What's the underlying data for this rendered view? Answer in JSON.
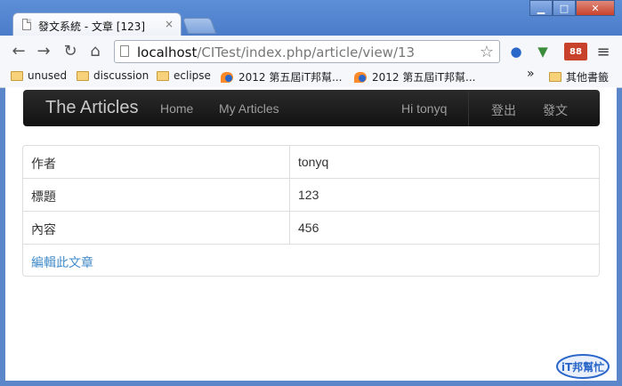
{
  "browser": {
    "tab_title": "發文系統 - 文章 [123]",
    "tab_close": "×",
    "url_host": "localhost",
    "url_path": "/CITest/index.php/article/view/13",
    "ext_badge": "88"
  },
  "bookmarks": {
    "items": [
      "unused",
      "discussion",
      "eclipse",
      "2012 第五屆iT邦幫...",
      "2012 第五屆iT邦幫..."
    ],
    "overflow": "»",
    "other": "其他書籤"
  },
  "navbar": {
    "brand": "The Articles",
    "home": "Home",
    "my_articles": "My Articles",
    "greeting": "Hi tonyq",
    "logout": "登出",
    "post": "發文"
  },
  "article": {
    "rows": [
      {
        "key": "作者",
        "value": "tonyq"
      },
      {
        "key": "標題",
        "value": "123"
      },
      {
        "key": "內容",
        "value": "456"
      }
    ],
    "edit_link": "編輯此文章"
  },
  "watermark": {
    "logo": "iT邦幫忙"
  }
}
